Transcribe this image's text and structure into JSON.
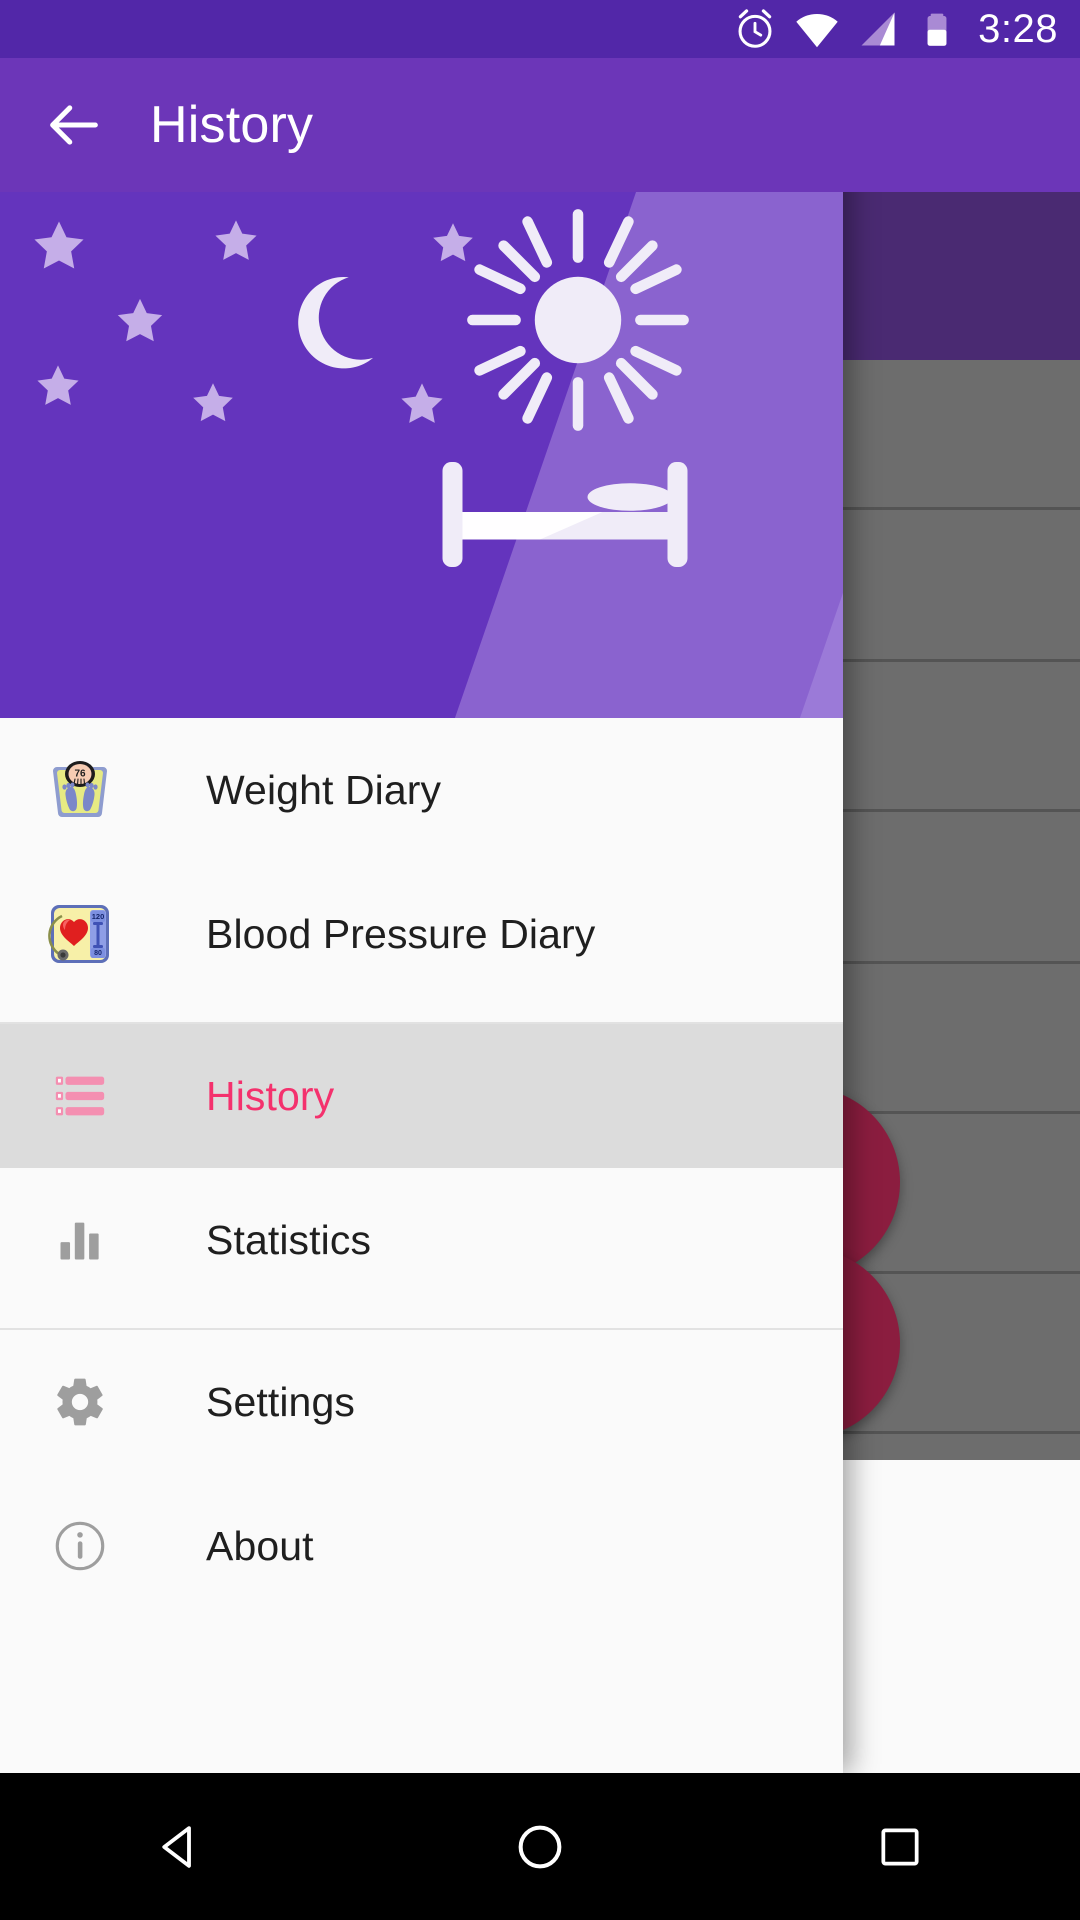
{
  "status_bar": {
    "time": "3:28",
    "icons": [
      "alarm-icon",
      "wifi-icon",
      "cellular-signal-icon",
      "battery-icon"
    ]
  },
  "app_bar": {
    "back_icon": "back-arrow-icon",
    "title": "History"
  },
  "drawer": {
    "header": {
      "illustration": "night-to-day-sleep-illustration",
      "elements": [
        "stars",
        "crescent-moon",
        "sun",
        "bed"
      ],
      "colors": {
        "band_dark": "#6434bd",
        "band_mid": "#8a63cf",
        "band_light": "#9b7ad8",
        "star": "#c5aee8",
        "figure": "#f0ecf8"
      }
    },
    "groups": [
      {
        "items": [
          {
            "label": "Weight Diary",
            "icon": "weight-scale-icon",
            "icon_value": "76",
            "selected": false
          },
          {
            "label": "Blood Pressure Diary",
            "icon": "blood-pressure-icon",
            "icon_systolic": "120",
            "icon_diastolic": "80",
            "selected": false
          }
        ]
      },
      {
        "items": [
          {
            "label": "History",
            "icon": "list-icon",
            "selected": true
          },
          {
            "label": "Statistics",
            "icon": "bar-chart-icon",
            "selected": false
          }
        ]
      },
      {
        "items": [
          {
            "label": "Settings",
            "icon": "gear-icon",
            "selected": false
          },
          {
            "label": "About",
            "icon": "info-icon",
            "selected": false
          }
        ]
      }
    ],
    "selected_color": "#f4316d",
    "selected_row_background": "#dcdcdc"
  },
  "background_screen": {
    "scrim": true,
    "fabs": [
      {
        "name": "voice-input-fab",
        "icon": "microphone-icon",
        "color": "#8b1d3f"
      },
      {
        "name": "add-entry-fab",
        "icon": "plus-icon",
        "color": "#8b1d3f"
      }
    ]
  },
  "nav_bar": {
    "buttons": [
      {
        "name": "back-nav-button",
        "icon": "triangle-back-icon"
      },
      {
        "name": "home-nav-button",
        "icon": "circle-home-icon"
      },
      {
        "name": "recents-nav-button",
        "icon": "square-recents-icon"
      }
    ]
  },
  "theme": {
    "status_bar_color": "#5227a8",
    "app_bar_color": "#6c36b8",
    "drawer_background": "#fafafa",
    "accent": "#f4316d"
  }
}
